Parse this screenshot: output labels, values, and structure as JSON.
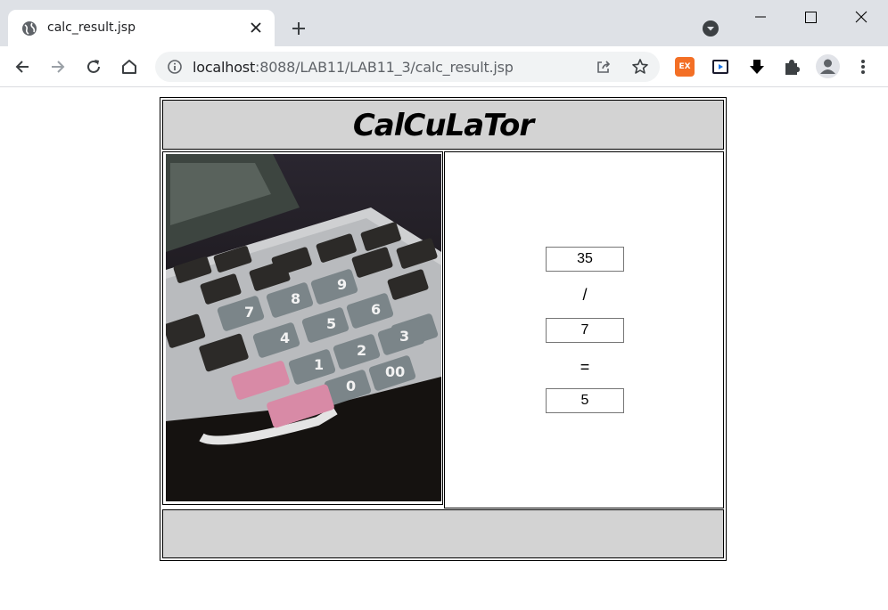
{
  "browser": {
    "tab_title": "calc_result.jsp",
    "url_host": "localhost",
    "url_rest": ":8088/LAB11/LAB11_3/calc_result.jsp",
    "extensions": [
      "EX",
      "media-icon",
      "download-icon",
      "puzzle-icon"
    ]
  },
  "page": {
    "title": "CalCuLaTor",
    "operand1": "35",
    "operator": "/",
    "operand2": "7",
    "equals": "=",
    "result": "5"
  },
  "colors": {
    "header_bg": "#d3d3d3",
    "tabstrip_bg": "#dee1e6",
    "omnibox_bg": "#f1f3f4",
    "ex_extension": "#f36f25"
  }
}
